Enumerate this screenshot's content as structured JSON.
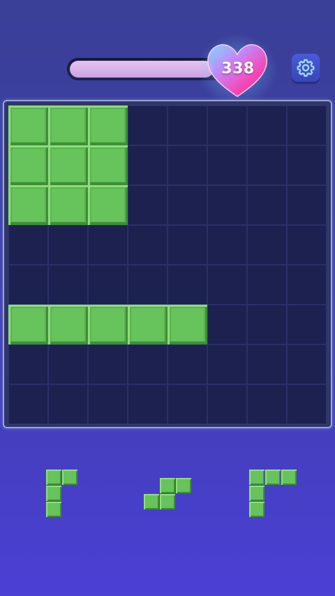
{
  "header": {
    "score": "338",
    "progress": 0.93,
    "colors": {
      "progress_fill": "#d9b6ea",
      "heart_left": "#6fd7ff",
      "heart_right": "#ff3fa6"
    },
    "settings_icon": "gear-icon"
  },
  "board": {
    "rows": 8,
    "cols": 8,
    "block_color": "#67c35b",
    "empty_color": "#1d2150",
    "filled_cells": [
      [
        0,
        0
      ],
      [
        0,
        1
      ],
      [
        0,
        2
      ],
      [
        1,
        0
      ],
      [
        1,
        1
      ],
      [
        1,
        2
      ],
      [
        2,
        0
      ],
      [
        2,
        1
      ],
      [
        2,
        2
      ],
      [
        5,
        0
      ],
      [
        5,
        1
      ],
      [
        5,
        2
      ],
      [
        5,
        3
      ],
      [
        5,
        4
      ]
    ]
  },
  "tray": {
    "pieces": [
      {
        "name": "l-corner-piece",
        "cells": [
          [
            0,
            0
          ],
          [
            0,
            1
          ],
          [
            1,
            0
          ],
          [
            2,
            0
          ]
        ]
      },
      {
        "name": "s-shape-piece",
        "cells": [
          [
            0,
            1
          ],
          [
            0,
            2
          ],
          [
            1,
            0
          ],
          [
            1,
            1
          ]
        ]
      },
      {
        "name": "big-l-corner-piece",
        "cells": [
          [
            0,
            0
          ],
          [
            0,
            1
          ],
          [
            0,
            2
          ],
          [
            1,
            0
          ],
          [
            2,
            0
          ]
        ]
      }
    ]
  }
}
